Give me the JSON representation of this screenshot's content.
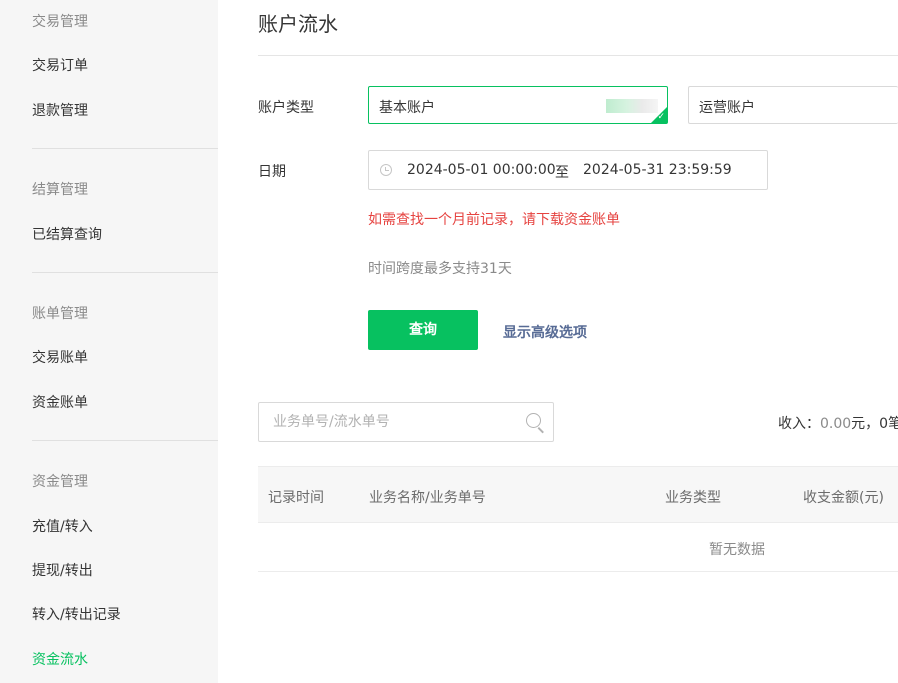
{
  "sidebar": {
    "groups": [
      {
        "title": "交易管理",
        "items": [
          "交易订单",
          "退款管理"
        ]
      },
      {
        "title": "结算管理",
        "items": [
          "已结算查询"
        ]
      },
      {
        "title": "账单管理",
        "items": [
          "交易账单",
          "资金账单"
        ]
      },
      {
        "title": "资金管理",
        "items": [
          "充值/转入",
          "提现/转出",
          "转入/转出记录",
          "资金流水"
        ]
      }
    ],
    "active_item": "资金流水"
  },
  "page": {
    "title": "账户流水"
  },
  "filters": {
    "account_type_label": "账户类型",
    "account_options": [
      "基本账户",
      "运营账户"
    ],
    "selected_account": "基本账户",
    "date_label": "日期",
    "date_start": "2024-05-01 00:00:00",
    "date_separator": "至",
    "date_end": "2024-05-31 23:59:59",
    "warning": "如需查找一个月前记录，请下载资金账单",
    "tip": "时间跨度最多支持31天",
    "query_button": "查询",
    "advanced_link": "显示高级选项"
  },
  "search": {
    "placeholder": "业务单号/流水单号"
  },
  "summary": {
    "income_label": "收入：",
    "income_value": "0.00",
    "income_unit": "元，",
    "count_value": "0",
    "count_unit": "笔"
  },
  "table": {
    "columns": [
      "记录时间",
      "业务名称/业务单号",
      "业务类型",
      "收支金额(元)"
    ],
    "empty_text": "暂无数据"
  },
  "colors": {
    "accent": "#07c160",
    "warning": "#e64340",
    "link": "#576b95"
  }
}
